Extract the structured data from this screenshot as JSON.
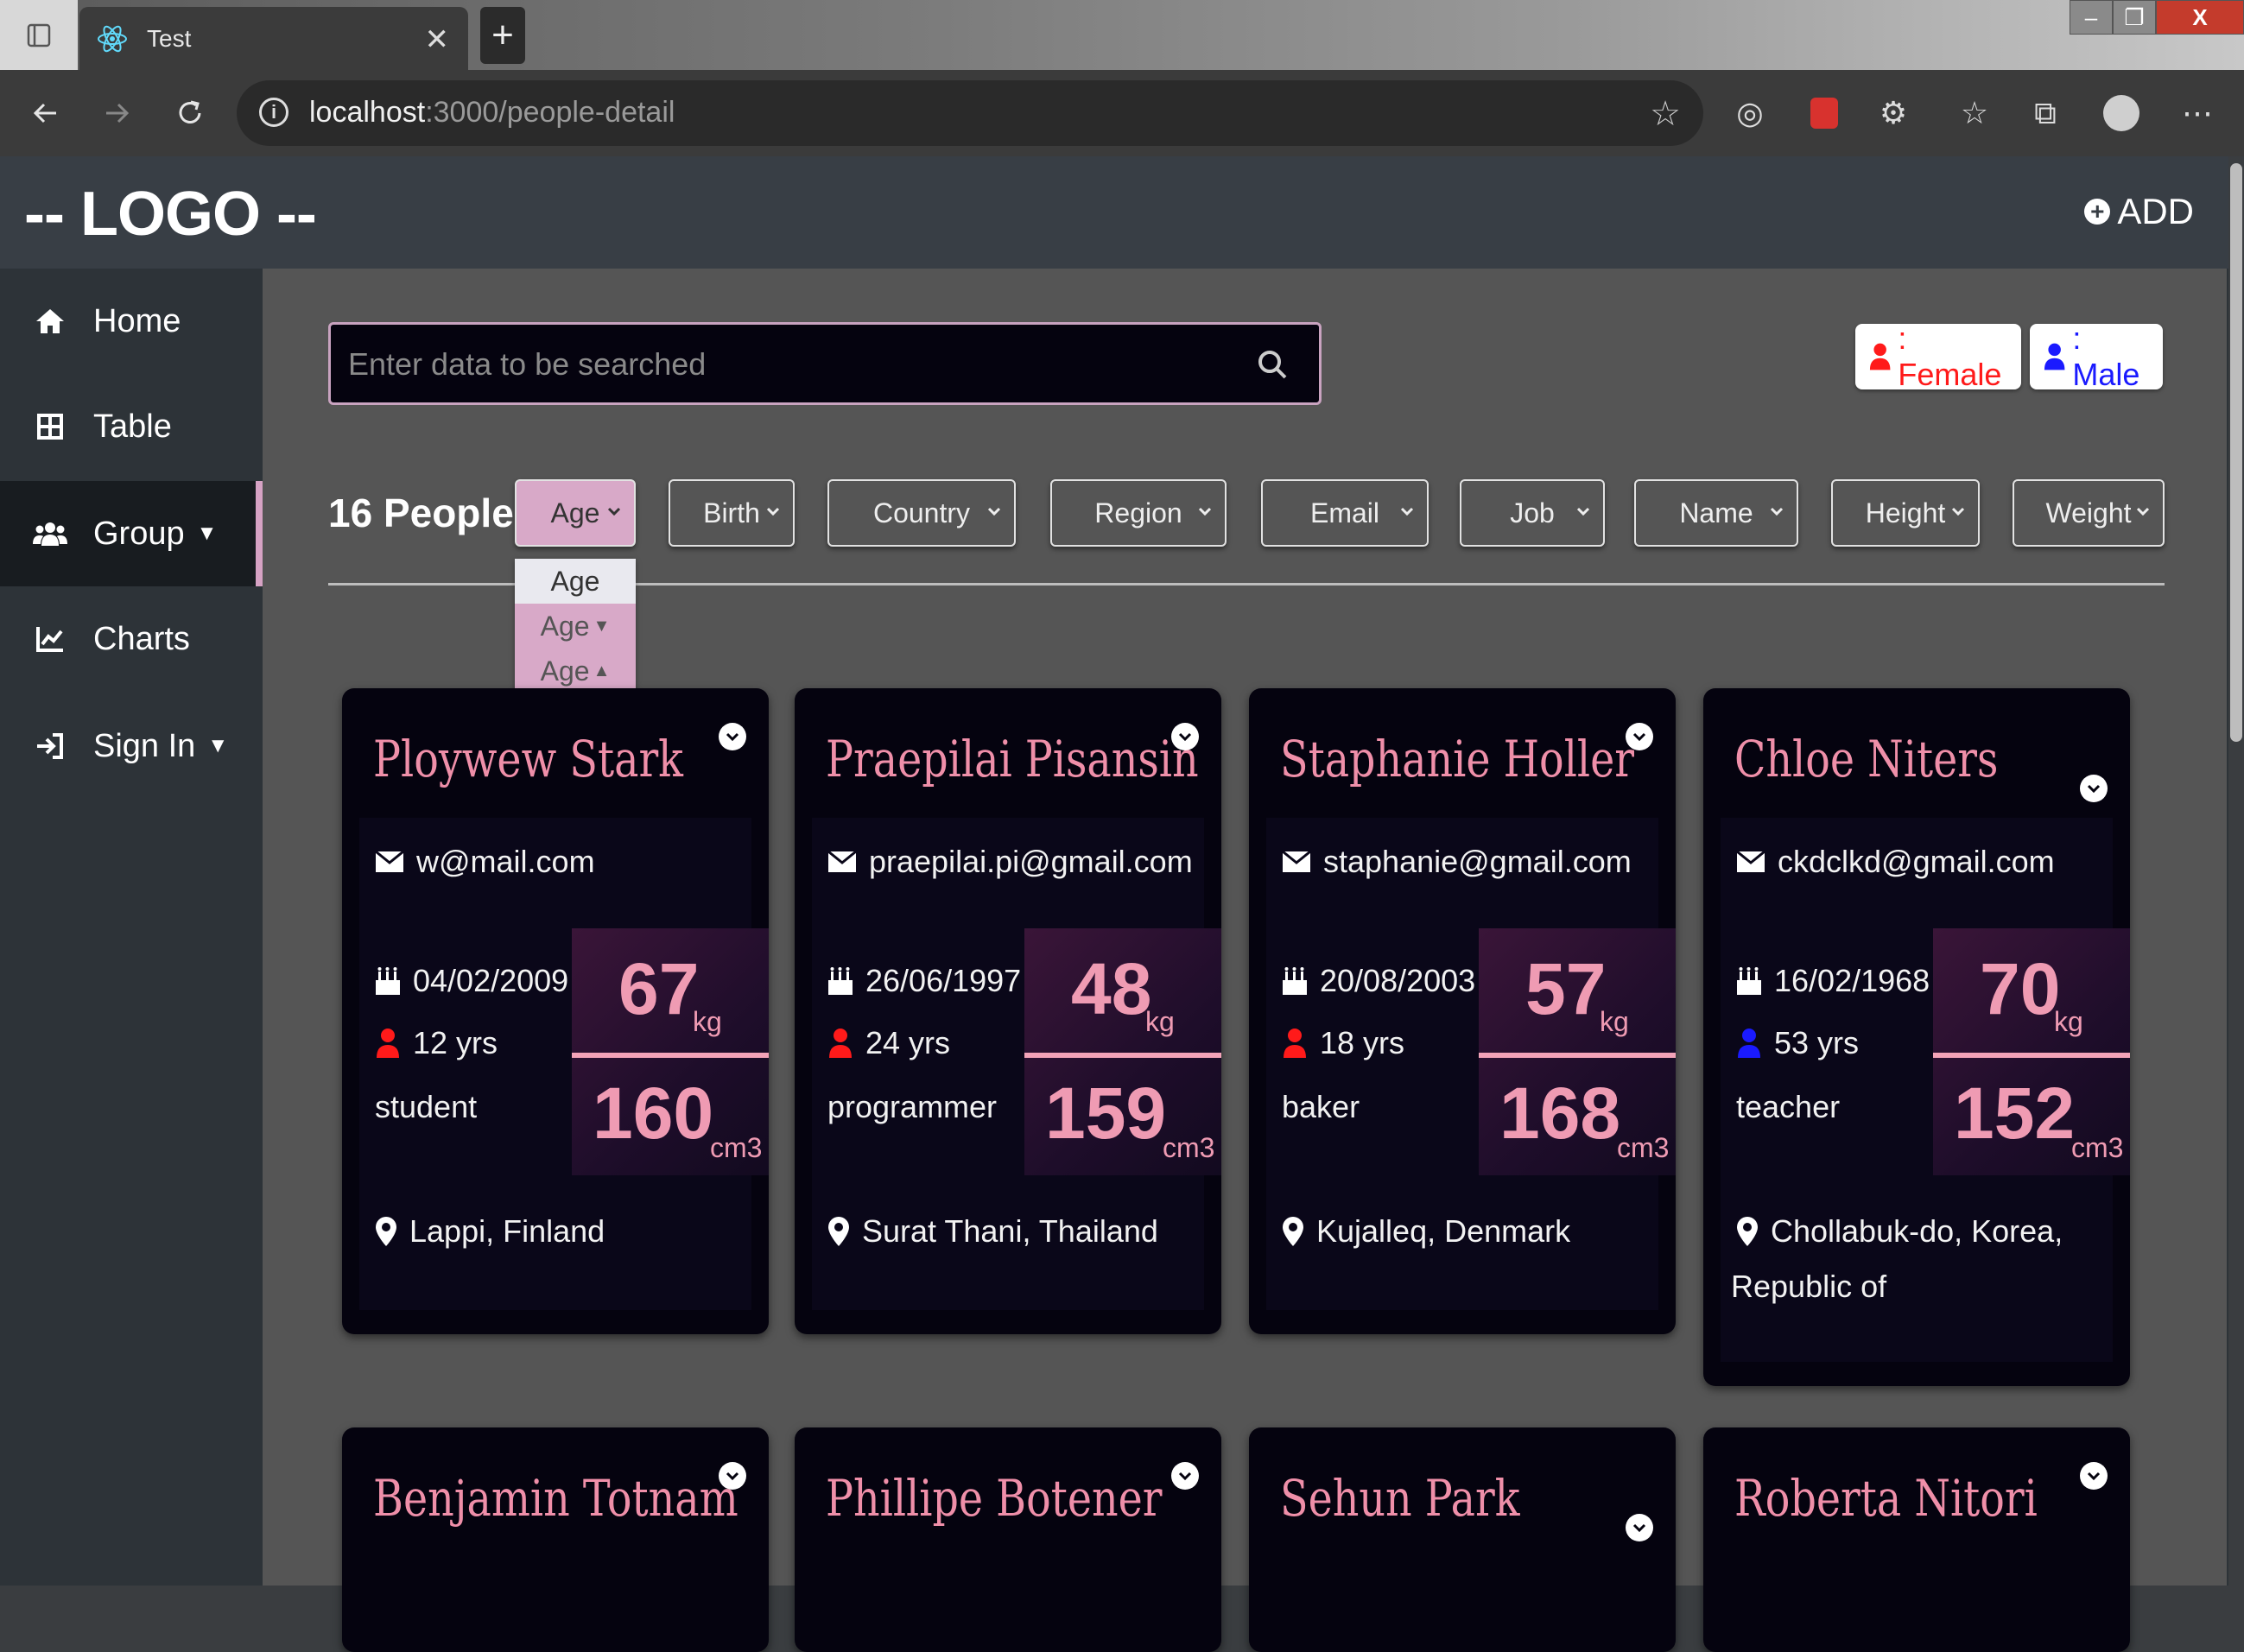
{
  "browser": {
    "tab_title": "Test",
    "url_host": "localhost",
    "url_path": ":3000/people-detail"
  },
  "header": {
    "logo": "-- LOGO --",
    "add_label": "ADD"
  },
  "sidebar": {
    "items": [
      {
        "label": "Home",
        "icon": "home-icon"
      },
      {
        "label": "Table",
        "icon": "table-icon"
      },
      {
        "label": "Group",
        "icon": "users-icon",
        "active": true
      },
      {
        "label": "Charts",
        "icon": "chart-icon"
      },
      {
        "label": "Sign In",
        "icon": "sign-in-icon"
      }
    ]
  },
  "search": {
    "placeholder": "Enter data to be searched"
  },
  "legend": {
    "female": ": Female",
    "male": ": Male",
    "female_color": "#ff1a1a",
    "male_color": "#1a1aff"
  },
  "filters": {
    "count": "16 People",
    "options": [
      "Age",
      "Birth",
      "Country",
      "Region",
      "Email",
      "Job",
      "Name",
      "Height",
      "Weight"
    ],
    "age_dropdown": [
      "Age",
      "Age",
      "Age"
    ]
  },
  "colors": {
    "accent": "#ef8fa9",
    "filter_active": "#d8a9c8",
    "card_bg": "#05030f"
  },
  "cards": [
    {
      "name": "Ploywew Stark",
      "email": "w@mail.com",
      "birth": "04/02/2009",
      "age": "12 yrs",
      "job": "student",
      "weight": "67",
      "weight_unit": "kg",
      "height": "160",
      "height_unit": "cm3",
      "location": "Lappi, Finland",
      "gender": "female"
    },
    {
      "name": "Praepilai Pisansin",
      "email": "praepilai.pi@gmail.com",
      "birth": "26/06/1997",
      "age": "24 yrs",
      "job": "programmer",
      "weight": "48",
      "weight_unit": "kg",
      "height": "159",
      "height_unit": "cm3",
      "location": "Surat Thani, Thailand",
      "gender": "female"
    },
    {
      "name": "Staphanie Holler",
      "email": "staphanie@gmail.com",
      "birth": "20/08/2003",
      "age": "18 yrs",
      "job": "baker",
      "weight": "57",
      "weight_unit": "kg",
      "height": "168",
      "height_unit": "cm3",
      "location": "Kujalleq, Denmark",
      "gender": "female"
    },
    {
      "name": "Chloe Niters",
      "email": "ckdclkd@gmail.com",
      "birth": "16/02/1968",
      "age": "53 yrs",
      "job": "teacher",
      "weight": "70",
      "weight_unit": "kg",
      "height": "152",
      "height_unit": "cm3",
      "location": "Chollabuk-do, Korea,",
      "location2": "Republic of",
      "gender": "male"
    },
    {
      "name": "Benjamin Totnam"
    },
    {
      "name": "Phillipe Botener"
    },
    {
      "name": "Sehun Park"
    },
    {
      "name": "Roberta Nitori"
    }
  ]
}
